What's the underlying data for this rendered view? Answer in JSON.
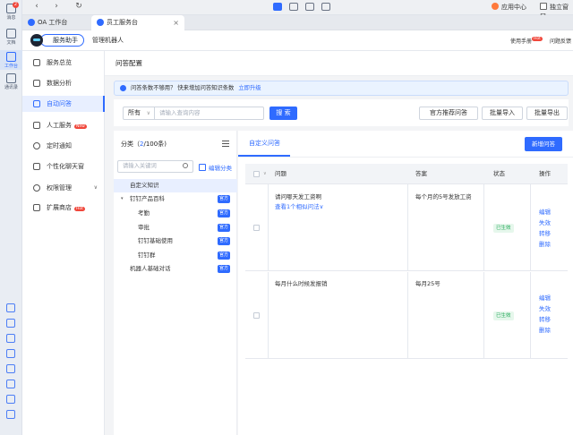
{
  "rail": {
    "items": [
      {
        "label": "消息",
        "badge": "2"
      },
      {
        "label": "文档"
      },
      {
        "label": "工作台"
      },
      {
        "label": "通讯录"
      }
    ]
  },
  "browser": {
    "nav_back": "‹",
    "nav_forward": "›",
    "nav_refresh": "↻",
    "app_center": "应用中心",
    "standalone_window": "独立窗口"
  },
  "tabs": [
    {
      "label": "OA 工作台",
      "active": false
    },
    {
      "label": "员工服务台",
      "active": true,
      "close": "×"
    }
  ],
  "app_header": {
    "tab_assistant": "服务助手",
    "tab_manage": "管理机器人",
    "manual": "使用手册",
    "hot_badge": "Hot",
    "feedback": "问题反馈"
  },
  "menu": {
    "items": [
      {
        "label": "服务总览"
      },
      {
        "label": "数据分析"
      },
      {
        "label": "自动问答",
        "active": true
      },
      {
        "label": "人工服务",
        "badge": "New"
      },
      {
        "label": "定时通知"
      },
      {
        "label": "个性化聊天窗"
      },
      {
        "label": "权限管理",
        "caret": "∨"
      },
      {
        "label": "扩展商店",
        "badge": "Hot"
      }
    ]
  },
  "page": {
    "title": "问答配置",
    "notice": "问答条数不够用？ 快来增加问答知识条数",
    "notice_link": "立即升级"
  },
  "search": {
    "scope": "所有",
    "placeholder": "请输入查询内容",
    "search_btn": "搜 索",
    "recommend_btn": "官方推荐问答",
    "import_btn": "批量导入",
    "export_btn": "批量导出"
  },
  "categories": {
    "title_prefix": "分类（",
    "count": "2",
    "title_suffix": "/100条)",
    "search_placeholder": "请输入关键词",
    "edit_label": "编辑分类",
    "official_tag": "官方",
    "items": [
      {
        "label": "自定义知识"
      },
      {
        "label": "钉钉产品百科",
        "caret": "▾"
      },
      {
        "label": "考勤"
      },
      {
        "label": "审批"
      },
      {
        "label": "钉钉基础使用"
      },
      {
        "label": "钉钉群"
      },
      {
        "label": "机器人基础对话"
      }
    ]
  },
  "qa": {
    "tab": "自定义问答",
    "new_btn": "新增问答",
    "headers": {
      "question": "问题",
      "answer": "答案",
      "status": "状态",
      "ops": "操作"
    },
    "rows": [
      {
        "question": "请问哪天发工资啊",
        "similar": "查看1个相似问法∨",
        "answer": "每个月的5号发放工资",
        "status": "已生效",
        "ops": [
          "编辑",
          "失效",
          "转移",
          "删除"
        ]
      },
      {
        "question": "每月什么时候发报销",
        "similar": "",
        "answer": "每月25号",
        "status": "已生效",
        "ops": [
          "编辑",
          "失效",
          "转移",
          "删除"
        ]
      }
    ]
  },
  "colors": {
    "primary": "#2f6bff",
    "success": "#20a957",
    "danger": "#f0473b"
  }
}
